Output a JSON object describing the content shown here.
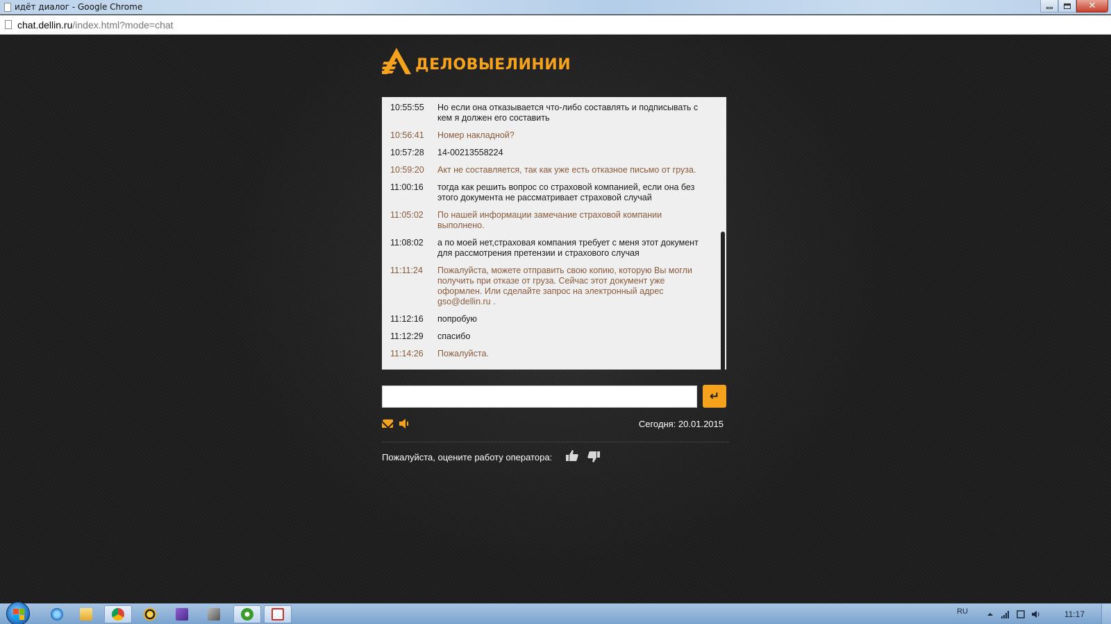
{
  "window": {
    "title": "идёт диалог - Google Chrome",
    "url_host": "chat.dellin.ru",
    "url_path": "/index.html?mode=chat"
  },
  "brand": {
    "name": "ДЕЛОВЫЕЛИНИИ",
    "accent_color": "#f6a21d"
  },
  "chat": {
    "messages": [
      {
        "time": "10:55:55",
        "text": "Но если она отказывается что-либо составлять и подписывать с кем я должен его составить",
        "sender": "user"
      },
      {
        "time": "10:56:41",
        "text": "Номер накладной?",
        "sender": "operator"
      },
      {
        "time": "10:57:28",
        "text": "14-00213558224",
        "sender": "user"
      },
      {
        "time": "10:59:20",
        "text": "Акт не составляется, так как уже есть отказное письмо от груза.",
        "sender": "operator"
      },
      {
        "time": "11:00:16",
        "text": "тогда как решить вопрос со страховой компанией, если она без этого документа не рассматривает страховой случай",
        "sender": "user"
      },
      {
        "time": "11:05:02",
        "text": "По нашей информации замечание страховой компании выполнено.",
        "sender": "operator"
      },
      {
        "time": "11:08:02",
        "text": "а по моей нет,страховая компания требует с меня этот документ для рассмотрения претензии и страхового случая",
        "sender": "user"
      },
      {
        "time": "11:11:24",
        "text": "Пожалуйста, можете отправить свою копию, которую Вы могли получить при отказе от груза. Сейчас этот документ уже оформлен. Или сделайте запрос на электронный адрес gso@dellin.ru .",
        "sender": "operator"
      },
      {
        "time": "11:12:16",
        "text": "попробую",
        "sender": "user"
      },
      {
        "time": "11:12:29",
        "text": "спасибо",
        "sender": "user"
      },
      {
        "time": "11:14:26",
        "text": "Пожалуйста.",
        "sender": "operator"
      }
    ],
    "input_value": "",
    "send_glyph": "↵",
    "date_label": "Сегодня:",
    "date_value": "20.01.2015",
    "rating_prompt": "Пожалуйста, оцените работу оператора:"
  },
  "taskbar": {
    "language": "RU",
    "clock": "11:17"
  }
}
